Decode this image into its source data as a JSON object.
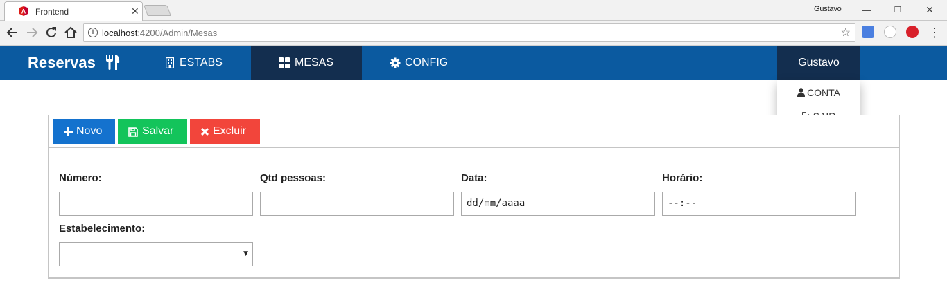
{
  "browser": {
    "tab_title": "Frontend",
    "profile_name": "Gustavo",
    "url_host": "localhost",
    "url_path": ":4200/Admin/Mesas",
    "icons": {
      "back": "arrow-left-icon",
      "forward": "arrow-right-icon",
      "reload": "reload-icon",
      "home": "home-icon",
      "info": "info-icon",
      "bookmark": "star-icon"
    }
  },
  "app": {
    "brand": "Reservas",
    "nav": [
      {
        "label": "ESTABS",
        "icon": "building-icon",
        "active": false
      },
      {
        "label": "MESAS",
        "icon": "th-large-icon",
        "active": true
      },
      {
        "label": "CONFIG",
        "icon": "gear-icon",
        "active": false
      }
    ],
    "user": {
      "name": "Gustavo",
      "menu": [
        {
          "label": "CONTA",
          "icon": "user-icon"
        },
        {
          "label": "SAIR",
          "icon": "sign-out-icon"
        }
      ]
    },
    "colors": {
      "navbar": "#0b5aa0",
      "nav_active": "#132e4f",
      "novo": "#1472ce",
      "salvar": "#13c45b",
      "excluir": "#f2453b"
    }
  },
  "form": {
    "buttons": {
      "novo": "Novo",
      "salvar": "Salvar",
      "excluir": "Excluir"
    },
    "fields": {
      "numero": {
        "label": "Número:",
        "value": ""
      },
      "qtd_pessoas": {
        "label": "Qtd pessoas:",
        "value": ""
      },
      "data": {
        "label": "Data:",
        "value": "dd/mm/aaaa"
      },
      "horario": {
        "label": "Horário:",
        "value": "--:--"
      },
      "estabelecimento": {
        "label": "Estabelecimento:",
        "value": ""
      }
    }
  }
}
